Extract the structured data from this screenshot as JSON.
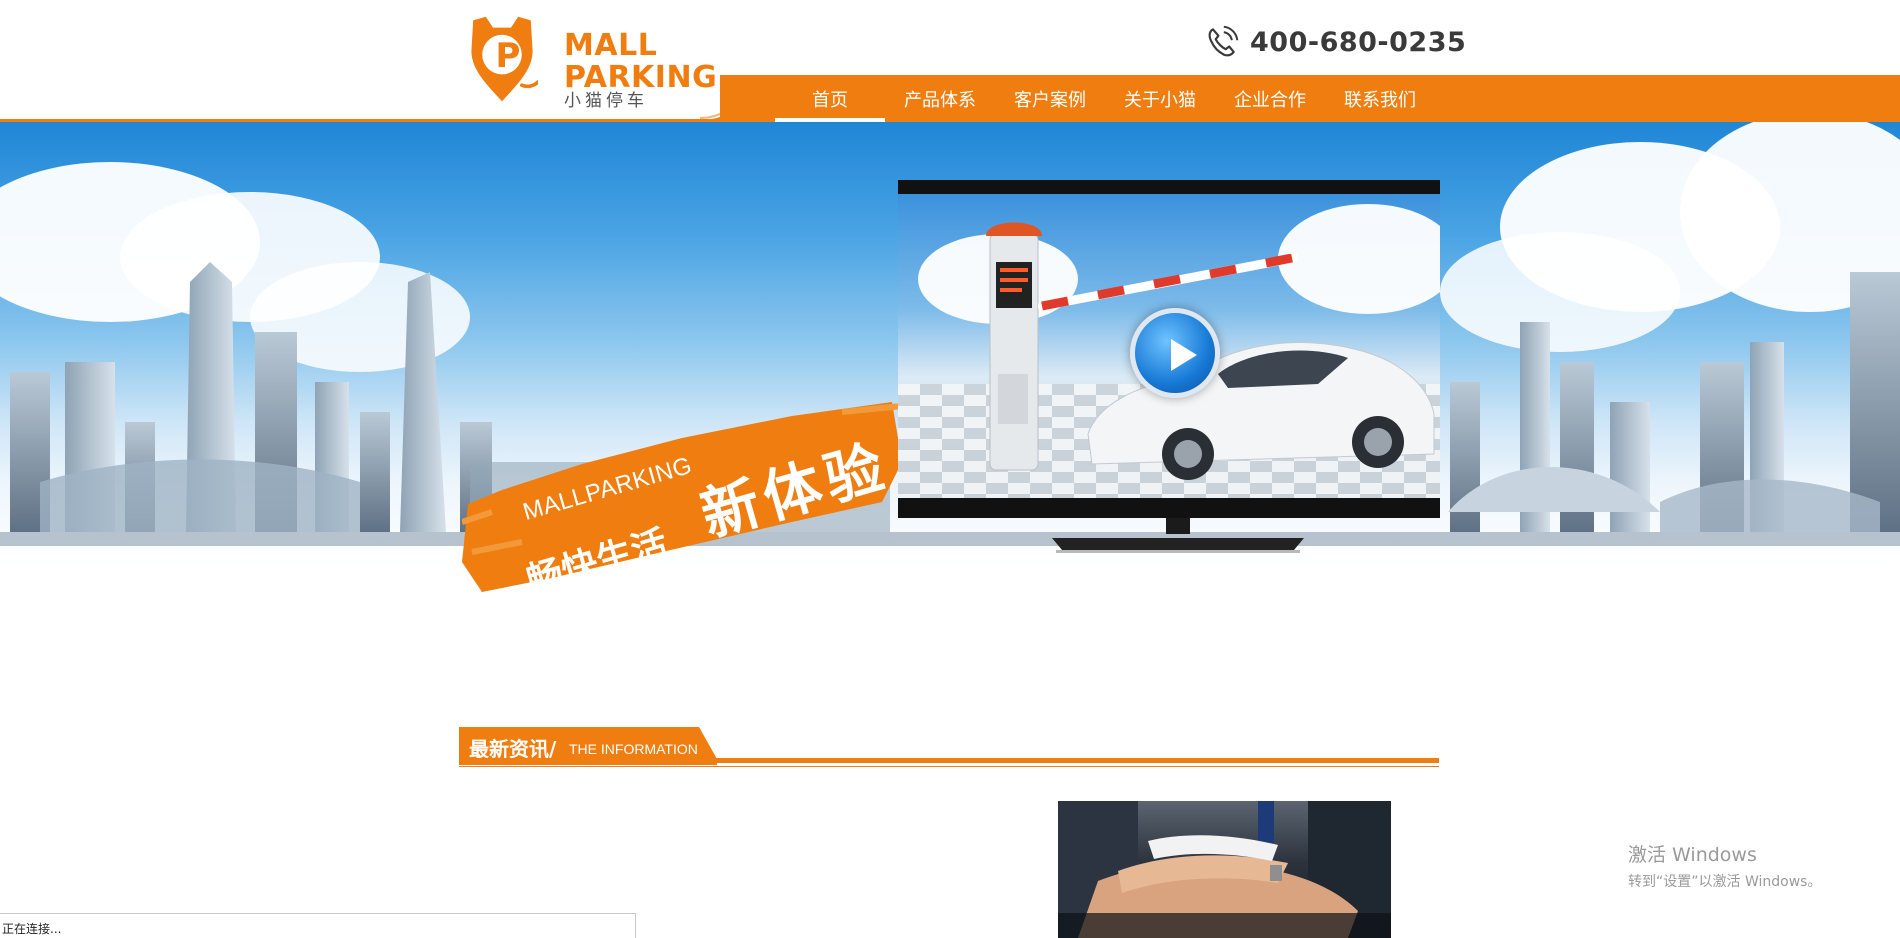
{
  "logo": {
    "mark_letter": "P",
    "line1": "MALL",
    "line2": "PARKING",
    "cn": "小猫停车"
  },
  "phone": {
    "icon": "phone-icon",
    "number": "400-680-0235"
  },
  "nav": {
    "items": [
      {
        "label": "首页",
        "active": true
      },
      {
        "label": "产品体系",
        "active": false
      },
      {
        "label": "客户案例",
        "active": false
      },
      {
        "label": "关于小猫",
        "active": false
      },
      {
        "label": "企业合作",
        "active": false
      },
      {
        "label": "联系我们",
        "active": false
      }
    ]
  },
  "banner": {
    "brand_en": "MALLPARKING",
    "slogan_small": "畅快生活",
    "slogan_big": "新体验",
    "video_play_icon": "play-icon"
  },
  "news": {
    "title_cn": "最新资讯/",
    "title_en": "THE INFORMATION"
  },
  "status_bar": {
    "text": "正在连接..."
  },
  "windows_watermark": {
    "line1": "激活 Windows",
    "line2": "转到“设置”以激活 Windows。"
  },
  "colors": {
    "accent": "#ef7d0f",
    "sky_top": "#1f86d6",
    "nav_text": "#ffffff",
    "phone_text": "#3a3a3a"
  }
}
